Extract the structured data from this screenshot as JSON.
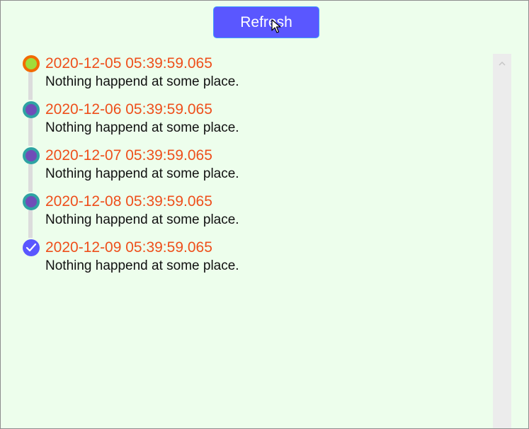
{
  "toolbar": {
    "refresh_label": "Refresh"
  },
  "timeline": {
    "items": [
      {
        "time": "2020-12-05 05:39:59.065",
        "text": "Nothing happend at some place.",
        "state": "current"
      },
      {
        "time": "2020-12-06 05:39:59.065",
        "text": "Nothing happend at some place.",
        "state": "pending"
      },
      {
        "time": "2020-12-07 05:39:59.065",
        "text": "Nothing happend at some place.",
        "state": "pending"
      },
      {
        "time": "2020-12-08 05:39:59.065",
        "text": "Nothing happend at some place.",
        "state": "pending"
      },
      {
        "time": "2020-12-09 05:39:59.065",
        "text": "Nothing happend at some place.",
        "state": "done"
      }
    ]
  },
  "icons": {
    "refresh_cursor": "mouse-pointer-icon",
    "current_marker": "current-dot-icon",
    "pending_marker": "pending-dot-icon",
    "done_marker": "check-circle-icon",
    "scroll_up": "chevron-up-icon"
  },
  "colors": {
    "background": "#edfeec",
    "accent": "#5a57ff",
    "time_text": "#ee4f1b",
    "current_ring": "#f26a00",
    "current_fill": "#a0dc3a",
    "pending_ring": "#2ea3a3",
    "pending_fill": "#6f4db8"
  }
}
